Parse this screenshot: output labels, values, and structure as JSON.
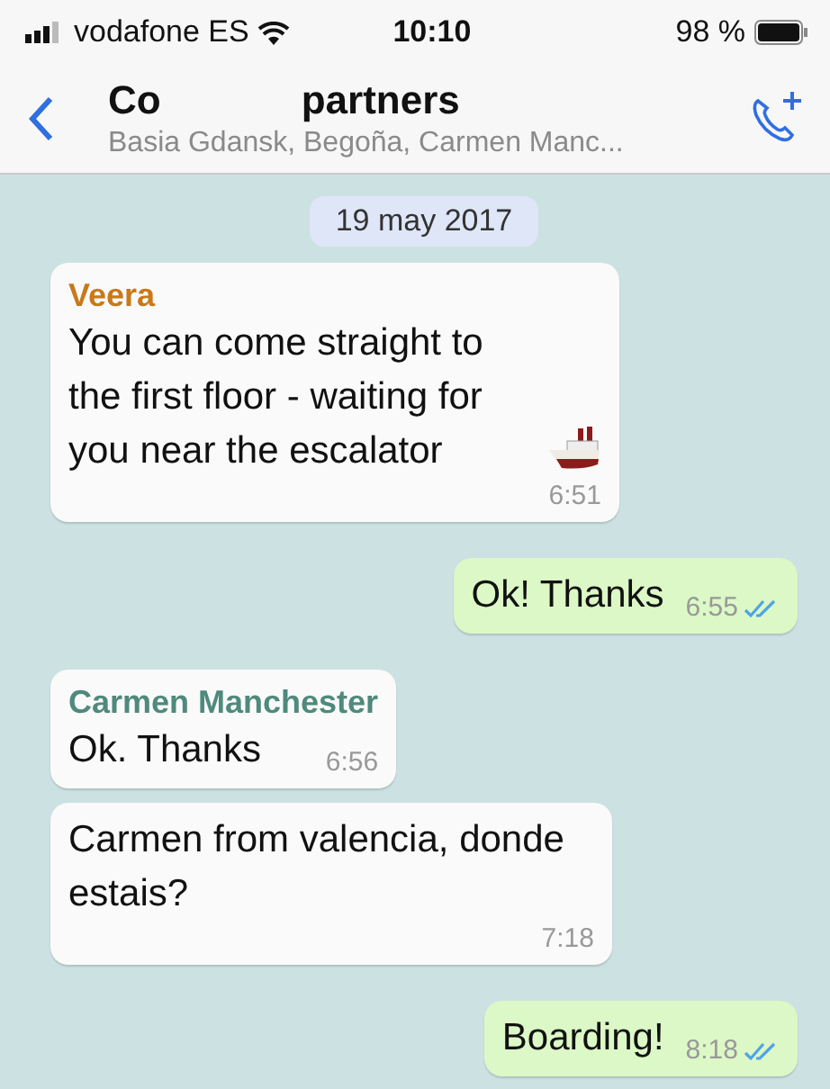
{
  "status_bar": {
    "carrier": "vodafone ES",
    "time": "10:10",
    "battery": "98 %"
  },
  "header": {
    "title_start": "Co",
    "title_end": "partners",
    "members": "Basia Gdansk, Begoña, Carmen Manc..."
  },
  "date": "19 may 2017",
  "messages": [
    {
      "kind": "incoming",
      "sender": "Veera",
      "color": "#c8791a",
      "text": "You can come straight to the first floor - waiting for you near the escalator",
      "trailing_icon": true,
      "time": "6:51"
    },
    {
      "kind": "outgoing",
      "text": "Ok! Thanks",
      "time": "6:55",
      "read": true
    },
    {
      "kind": "incoming",
      "sender": "Carmen Manchester",
      "color": "#4f8a7c",
      "text": "Ok. Thanks",
      "time": "6:56"
    },
    {
      "kind": "incoming",
      "text": "Carmen from valencia, donde estais?",
      "time": "7:18"
    },
    {
      "kind": "outgoing",
      "text": "Boarding!",
      "time": "8:18",
      "read": true
    }
  ]
}
